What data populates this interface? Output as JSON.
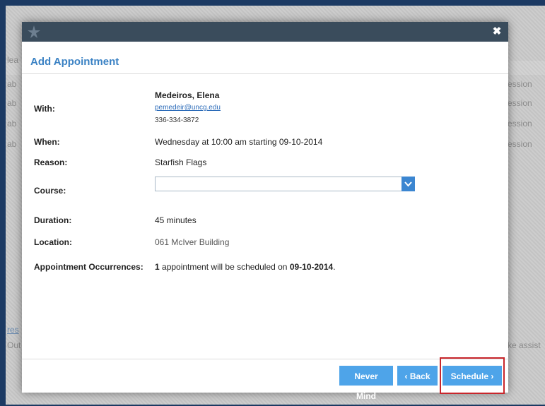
{
  "modal": {
    "title": "Add Appointment",
    "close_icon": "close-icon"
  },
  "fields": {
    "with_label": "With:",
    "with_name": "Medeiros, Elena",
    "with_email": "pemedeir@uncg.edu",
    "with_phone": "336-334-3872",
    "when_label": "When:",
    "when_value": "Wednesday at 10:00 am starting 09-10-2014",
    "reason_label": "Reason:",
    "reason_value": "Starfish Flags",
    "course_label": "Course:",
    "course_value": "",
    "duration_label": "Duration:",
    "duration_value": "45 minutes",
    "location_label": "Location:",
    "location_value": "061 McIver Building",
    "occurrences_label": "Appointment Occurrences:",
    "occurrences_count": "1",
    "occurrences_text": " appointment will be scheduled on ",
    "occurrences_date": "09-10-2014",
    "occurrences_period": "."
  },
  "buttons": {
    "never_mind": "Never Mind",
    "back": "‹ Back",
    "schedule": "Schedule ›"
  },
  "background": {
    "left_fragments": [
      "lea",
      "ab",
      "ab",
      "ab",
      "ab",
      "res",
      "Out"
    ],
    "right_fragments": [
      "ession",
      "ession",
      "ession",
      "ession",
      "ke assist"
    ]
  },
  "colors": {
    "accent": "#3b82c4",
    "button": "#4ea4e9",
    "titlebar": "#3a4c5c",
    "highlight": "#c8262b"
  }
}
